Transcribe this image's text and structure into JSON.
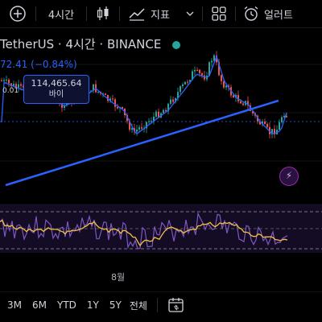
{
  "toolbar": {
    "interval_label": "4시간",
    "indicators_label": "지표",
    "alert_label": "얼러트"
  },
  "symbol": {
    "name": "TetherUS",
    "separator": "·",
    "interval": "4시간",
    "exchange": "BINANCE",
    "change": "72.41 (−0.84%)"
  },
  "price_tag": {
    "price": "114,465.64",
    "action": "바이"
  },
  "left_value": "0.01",
  "chart_data": {
    "type": "candlestick",
    "x_tick_labels": [
      "8월"
    ],
    "annotations": [
      "trendline"
    ],
    "indicator": "oscillator with moving-average",
    "colors": {
      "up": "#26a69a",
      "down": "#ef5350",
      "ma": "#2962ff",
      "trend": "#2962ff",
      "osc": "#7e57c2",
      "osc_signal": "#f5c042"
    }
  },
  "ranges": [
    "3M",
    "6M",
    "YTD",
    "1Y",
    "5Y",
    "전체"
  ],
  "icons": {
    "add": "plus-circle-icon",
    "candles": "candlestick-icon",
    "indicators": "indicators-icon",
    "layout": "grid-layout-icon",
    "alert": "alarm-clock-icon",
    "bolt": "lightning-icon",
    "date_range": "calendar-range-icon"
  }
}
